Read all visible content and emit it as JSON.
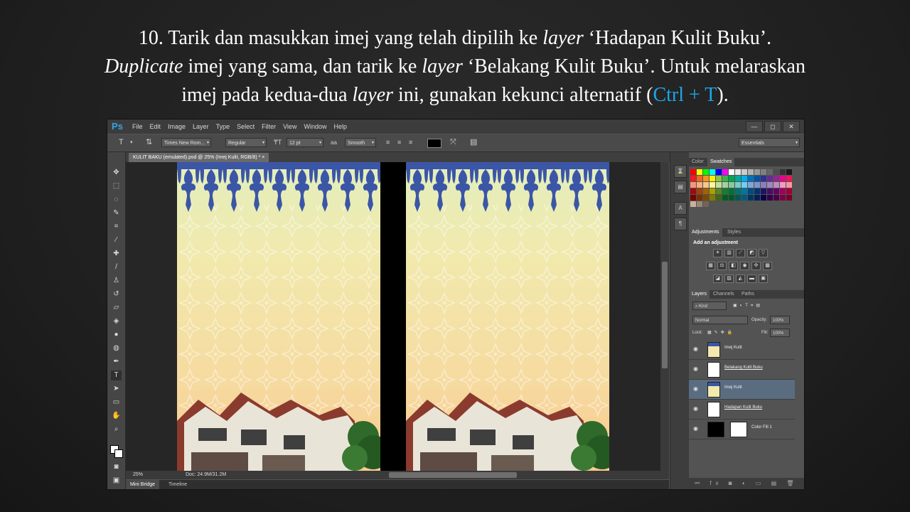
{
  "caption": {
    "line1_a": "10. Tarik dan masukkan imej yang telah dipilih ke ",
    "line1_i": "layer",
    "line1_b": " ‘Hadapan Kulit Buku’.",
    "line2_i1": "Duplicate",
    "line2_a": " imej yang sama, dan tarik ke ",
    "line2_i2": "layer",
    "line2_b": " ‘Belakang Kulit Buku’. Untuk melaraskan",
    "line3_a": "imej pada kedua-dua ",
    "line3_i": "layer",
    "line3_b": " ini, gunakan kekunci alternatif (",
    "line3_hl": "Ctrl + T",
    "line3_c": ")."
  },
  "app": {
    "logo": "Ps",
    "menu": [
      "File",
      "Edit",
      "Image",
      "Layer",
      "Type",
      "Select",
      "Filter",
      "View",
      "Window",
      "Help"
    ],
    "window_buttons": [
      "—",
      "◻",
      "✕"
    ]
  },
  "options": {
    "tool_glyph": "T",
    "font_family": "Times New Rom...",
    "font_style": "Regular",
    "font_size": "12 pt",
    "antialias": "Smooth",
    "workspace": "Essentials"
  },
  "document": {
    "tab_title": "KULIT BAKU (emulated).psd @ 25% (Imej Kulit, RGB/8) * ×",
    "zoom": "25%",
    "doc_size": "Doc: 24.9M/31.2M"
  },
  "bottom_tabs": [
    "Mini Bridge",
    "Timeline"
  ],
  "panels": {
    "color_tabs": [
      "Color",
      "Swatches"
    ],
    "adjust_tabs": [
      "Adjustments",
      "Styles"
    ],
    "add_adjustment": "Add an adjustment",
    "layers_tabs": [
      "Layers",
      "Channels",
      "Paths"
    ],
    "kind": "Kind",
    "blend_mode": "Normal",
    "opacity_label": "Opacity:",
    "opacity": "100%",
    "lock_label": "Lock:",
    "fill_label": "Fill:",
    "fill": "100%",
    "layers": [
      {
        "name": "Imej Kulit",
        "selected": false
      },
      {
        "name": "Belakang Kulit Buku",
        "selected": false
      },
      {
        "name": "Imej Kulit",
        "selected": true
      },
      {
        "name": "Hadapan Kulit Buku",
        "selected": false
      },
      {
        "name": "Color Fill 1",
        "selected": false
      }
    ]
  },
  "colors": {
    "accent": "#1ba7e6",
    "ornament": "#3b56a6",
    "selection": "#5a6c80"
  }
}
